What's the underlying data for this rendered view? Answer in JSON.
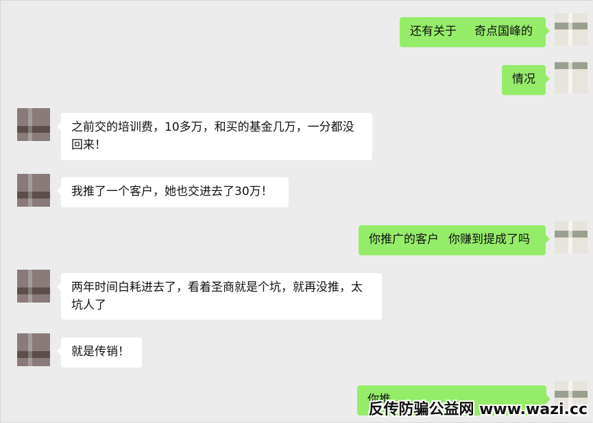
{
  "messages": [
    {
      "side": "out",
      "text_a": "还有关于",
      "text_b": "奇点国峰的"
    },
    {
      "side": "out",
      "text": "情况"
    },
    {
      "side": "in",
      "line1": "之前交的培训费，10多万，和买的基金几万，一分都没",
      "line2": "回来！"
    },
    {
      "side": "in",
      "text": "我推了一个客户，她也交进去了30万！"
    },
    {
      "side": "out",
      "text_a": "你推广的客户",
      "text_b": "你赚到提成了吗"
    },
    {
      "side": "in",
      "line1": "两年时间白耗进去了，看着圣商就是个坑，就再没推，太",
      "line2": "坑人了"
    },
    {
      "side": "in",
      "text": "就是传销！"
    },
    {
      "side": "out",
      "text": "你推"
    }
  ],
  "watermark": "反传防骗公益网 www.wazi.cc",
  "colors": {
    "background": "#ececec",
    "incoming_bubble": "#ffffff",
    "outgoing_bubble": "#95ec69"
  }
}
